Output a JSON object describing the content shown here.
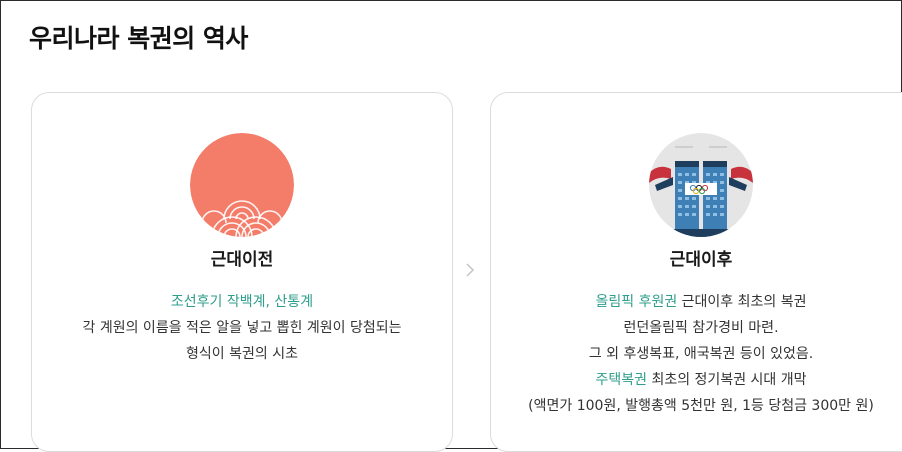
{
  "page": {
    "title": "우리나라 복권의 역사"
  },
  "cards": [
    {
      "title": "근대이전",
      "illustration_icon": "sun-wave-icon",
      "lines": [
        {
          "highlight": "조선후기 작백계, 산통계",
          "text": ""
        },
        {
          "highlight": "",
          "text": "각 계원의 이름을 적은 알을 넣고 뽑힌 계원이 당첨되는"
        },
        {
          "highlight": "",
          "text": "형식이 복권의 시초"
        }
      ]
    },
    {
      "title": "근대이후",
      "illustration_icon": "olympic-building-icon",
      "lines": [
        {
          "highlight": "올림픽 후원권",
          "text": " 근대이후 최초의 복권"
        },
        {
          "highlight": "",
          "text": "런던올림픽 참가경비 마련."
        },
        {
          "highlight": "",
          "text": "그 외 후생복표, 애국복권 등이 있었음."
        },
        {
          "highlight": "주택복권",
          "text": " 최초의 정기복권 시대 개막"
        },
        {
          "highlight": "",
          "text": "(액면가 100원, 발행총액 5천만 원, 1등 당첨금 300만 원)"
        }
      ]
    }
  ],
  "colors": {
    "accent_text": "#2f9e8b",
    "sun": "#f47d6a",
    "building_blue": "#3e7fb5",
    "building_red": "#c8323d"
  }
}
